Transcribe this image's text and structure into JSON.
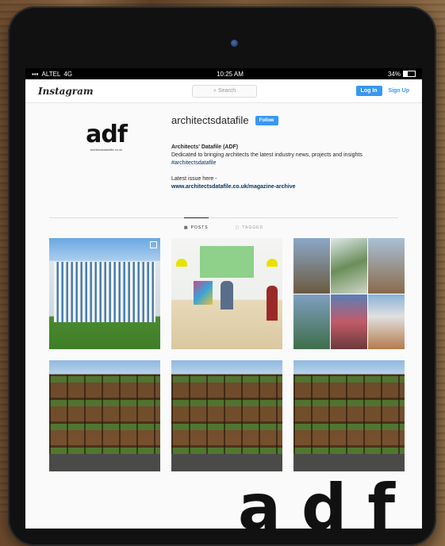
{
  "status_bar": {
    "carrier": "ALTEL",
    "network": "4G",
    "time": "10:25 AM",
    "battery": "34%",
    "battery_level": 0.34
  },
  "header": {
    "logo": "Instagram",
    "search_placeholder": "Search",
    "login_label": "Log In",
    "signup_label": "Sign Up"
  },
  "profile": {
    "avatar_text": "adf",
    "avatar_subtext": "architectsdatafile.co.uk",
    "username": "architectsdatafile",
    "follow_label": "Follow",
    "name": "Architects' Datafile (ADF)",
    "bio": "Dedicated to bringing architects the latest industry news, projects and insights",
    "hashtag": "#architectsdatafile",
    "issue_text": "Latest issue here -",
    "link": "www.architectsdatafile.co.uk/magazine-archive"
  },
  "tabs": [
    {
      "label": "POSTS",
      "icon": "grid-icon",
      "active": true
    },
    {
      "label": "TAGGED",
      "icon": "tag-icon",
      "active": false
    }
  ],
  "posts": [
    {
      "subject": "glass office building"
    },
    {
      "subject": "office interior"
    },
    {
      "subject": "project collage"
    },
    {
      "subject": "timber facade building"
    },
    {
      "subject": "timber facade building"
    },
    {
      "subject": "timber facade building"
    }
  ],
  "bottom_logo": "adf"
}
